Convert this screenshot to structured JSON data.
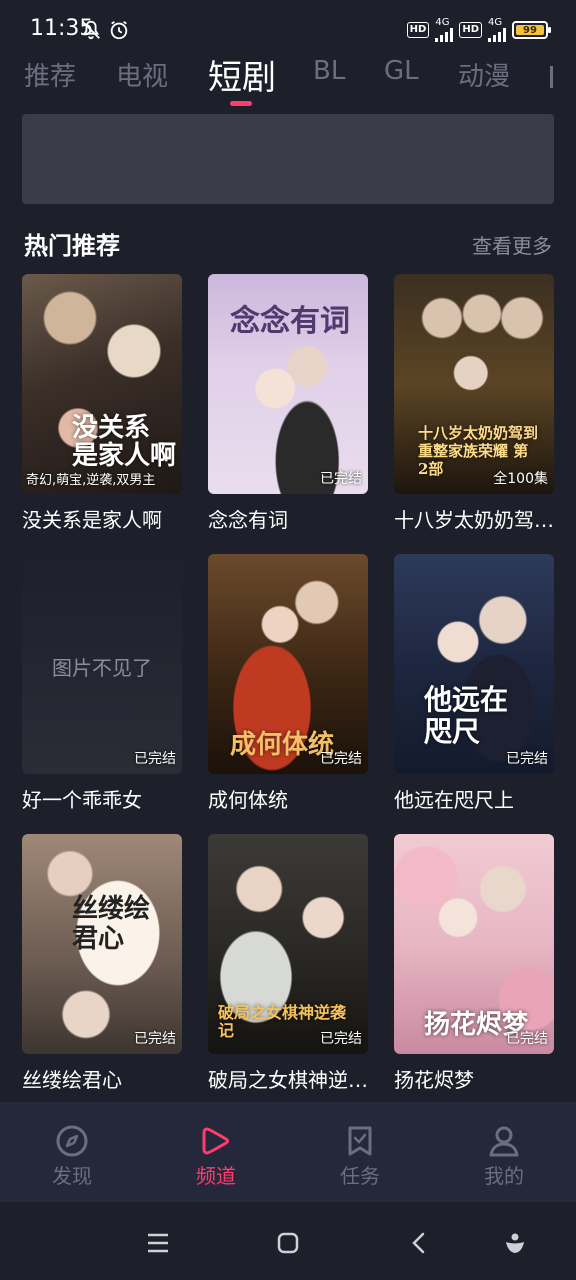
{
  "status_bar": {
    "time": "11:35",
    "network1": "4G",
    "network2": "4G",
    "hd": "HD",
    "battery": "99"
  },
  "tabs": [
    "推荐",
    "电视",
    "短剧",
    "BL",
    "GL",
    "动漫"
  ],
  "active_tab": "短剧",
  "section": {
    "title": "热门推荐",
    "more_label": "查看更多"
  },
  "items": [
    {
      "title": "没关系是家人啊",
      "poster_text": "没关系 是家人啊",
      "tag_left": "奇幻,萌宝,逆袭,双男主",
      "tag": ""
    },
    {
      "title": "念念有词",
      "poster_text": "念念有词",
      "tag_left": "",
      "tag": "已完结"
    },
    {
      "title": "十八岁太奶奶驾到，重整家族荣耀第2部",
      "poster_text": "十八岁太奶奶驾到 重整家族荣耀 第2部",
      "tag_left": "",
      "tag": "全100集"
    },
    {
      "title": "好一个乖乖女",
      "poster_text": "",
      "missing_text": "图片不见了",
      "tag_left": "",
      "tag": "已完结"
    },
    {
      "title": "成何体统",
      "poster_text": "成何体统",
      "tag_left": "",
      "tag": "已完结"
    },
    {
      "title": "他远在咫尺上",
      "poster_text": "他远在咫尺",
      "tag_left": "",
      "tag": "已完结"
    },
    {
      "title": "丝缕绘君心",
      "poster_text": "丝缕绘君心",
      "tag_left": "",
      "tag": "已完结"
    },
    {
      "title": "破局之女棋神逆袭记",
      "poster_text": "破局之女棋神逆袭记",
      "tag_left": "",
      "tag": "已完结"
    },
    {
      "title": "扬花烬梦",
      "poster_text": "扬花烬梦",
      "tag_left": "",
      "tag": "已完结"
    }
  ],
  "bottom_nav": [
    {
      "label": "发现",
      "icon": "compass-icon"
    },
    {
      "label": "频道",
      "icon": "play-icon"
    },
    {
      "label": "任务",
      "icon": "bookmark-check-icon"
    },
    {
      "label": "我的",
      "icon": "user-icon"
    }
  ],
  "active_nav": "频道",
  "colors": {
    "accent": "#ff3c6e",
    "background": "#1d1f2b",
    "muted": "#6b6e7e"
  }
}
